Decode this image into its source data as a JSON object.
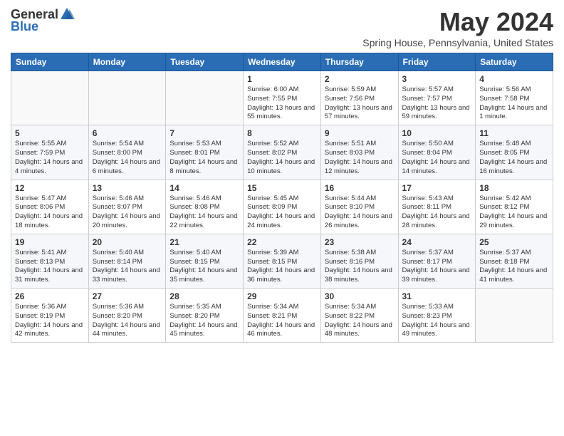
{
  "logo": {
    "general": "General",
    "blue": "Blue"
  },
  "header": {
    "month_year": "May 2024",
    "location": "Spring House, Pennsylvania, United States"
  },
  "weekdays": [
    "Sunday",
    "Monday",
    "Tuesday",
    "Wednesday",
    "Thursday",
    "Friday",
    "Saturday"
  ],
  "weeks": [
    [
      {
        "day": "",
        "sunrise": "",
        "sunset": "",
        "daylight": ""
      },
      {
        "day": "",
        "sunrise": "",
        "sunset": "",
        "daylight": ""
      },
      {
        "day": "",
        "sunrise": "",
        "sunset": "",
        "daylight": ""
      },
      {
        "day": "1",
        "sunrise": "Sunrise: 6:00 AM",
        "sunset": "Sunset: 7:55 PM",
        "daylight": "Daylight: 13 hours and 55 minutes."
      },
      {
        "day": "2",
        "sunrise": "Sunrise: 5:59 AM",
        "sunset": "Sunset: 7:56 PM",
        "daylight": "Daylight: 13 hours and 57 minutes."
      },
      {
        "day": "3",
        "sunrise": "Sunrise: 5:57 AM",
        "sunset": "Sunset: 7:57 PM",
        "daylight": "Daylight: 13 hours and 59 minutes."
      },
      {
        "day": "4",
        "sunrise": "Sunrise: 5:56 AM",
        "sunset": "Sunset: 7:58 PM",
        "daylight": "Daylight: 14 hours and 1 minute."
      }
    ],
    [
      {
        "day": "5",
        "sunrise": "Sunrise: 5:55 AM",
        "sunset": "Sunset: 7:59 PM",
        "daylight": "Daylight: 14 hours and 4 minutes."
      },
      {
        "day": "6",
        "sunrise": "Sunrise: 5:54 AM",
        "sunset": "Sunset: 8:00 PM",
        "daylight": "Daylight: 14 hours and 6 minutes."
      },
      {
        "day": "7",
        "sunrise": "Sunrise: 5:53 AM",
        "sunset": "Sunset: 8:01 PM",
        "daylight": "Daylight: 14 hours and 8 minutes."
      },
      {
        "day": "8",
        "sunrise": "Sunrise: 5:52 AM",
        "sunset": "Sunset: 8:02 PM",
        "daylight": "Daylight: 14 hours and 10 minutes."
      },
      {
        "day": "9",
        "sunrise": "Sunrise: 5:51 AM",
        "sunset": "Sunset: 8:03 PM",
        "daylight": "Daylight: 14 hours and 12 minutes."
      },
      {
        "day": "10",
        "sunrise": "Sunrise: 5:50 AM",
        "sunset": "Sunset: 8:04 PM",
        "daylight": "Daylight: 14 hours and 14 minutes."
      },
      {
        "day": "11",
        "sunrise": "Sunrise: 5:48 AM",
        "sunset": "Sunset: 8:05 PM",
        "daylight": "Daylight: 14 hours and 16 minutes."
      }
    ],
    [
      {
        "day": "12",
        "sunrise": "Sunrise: 5:47 AM",
        "sunset": "Sunset: 8:06 PM",
        "daylight": "Daylight: 14 hours and 18 minutes."
      },
      {
        "day": "13",
        "sunrise": "Sunrise: 5:46 AM",
        "sunset": "Sunset: 8:07 PM",
        "daylight": "Daylight: 14 hours and 20 minutes."
      },
      {
        "day": "14",
        "sunrise": "Sunrise: 5:46 AM",
        "sunset": "Sunset: 8:08 PM",
        "daylight": "Daylight: 14 hours and 22 minutes."
      },
      {
        "day": "15",
        "sunrise": "Sunrise: 5:45 AM",
        "sunset": "Sunset: 8:09 PM",
        "daylight": "Daylight: 14 hours and 24 minutes."
      },
      {
        "day": "16",
        "sunrise": "Sunrise: 5:44 AM",
        "sunset": "Sunset: 8:10 PM",
        "daylight": "Daylight: 14 hours and 26 minutes."
      },
      {
        "day": "17",
        "sunrise": "Sunrise: 5:43 AM",
        "sunset": "Sunset: 8:11 PM",
        "daylight": "Daylight: 14 hours and 28 minutes."
      },
      {
        "day": "18",
        "sunrise": "Sunrise: 5:42 AM",
        "sunset": "Sunset: 8:12 PM",
        "daylight": "Daylight: 14 hours and 29 minutes."
      }
    ],
    [
      {
        "day": "19",
        "sunrise": "Sunrise: 5:41 AM",
        "sunset": "Sunset: 8:13 PM",
        "daylight": "Daylight: 14 hours and 31 minutes."
      },
      {
        "day": "20",
        "sunrise": "Sunrise: 5:40 AM",
        "sunset": "Sunset: 8:14 PM",
        "daylight": "Daylight: 14 hours and 33 minutes."
      },
      {
        "day": "21",
        "sunrise": "Sunrise: 5:40 AM",
        "sunset": "Sunset: 8:15 PM",
        "daylight": "Daylight: 14 hours and 35 minutes."
      },
      {
        "day": "22",
        "sunrise": "Sunrise: 5:39 AM",
        "sunset": "Sunset: 8:15 PM",
        "daylight": "Daylight: 14 hours and 36 minutes."
      },
      {
        "day": "23",
        "sunrise": "Sunrise: 5:38 AM",
        "sunset": "Sunset: 8:16 PM",
        "daylight": "Daylight: 14 hours and 38 minutes."
      },
      {
        "day": "24",
        "sunrise": "Sunrise: 5:37 AM",
        "sunset": "Sunset: 8:17 PM",
        "daylight": "Daylight: 14 hours and 39 minutes."
      },
      {
        "day": "25",
        "sunrise": "Sunrise: 5:37 AM",
        "sunset": "Sunset: 8:18 PM",
        "daylight": "Daylight: 14 hours and 41 minutes."
      }
    ],
    [
      {
        "day": "26",
        "sunrise": "Sunrise: 5:36 AM",
        "sunset": "Sunset: 8:19 PM",
        "daylight": "Daylight: 14 hours and 42 minutes."
      },
      {
        "day": "27",
        "sunrise": "Sunrise: 5:36 AM",
        "sunset": "Sunset: 8:20 PM",
        "daylight": "Daylight: 14 hours and 44 minutes."
      },
      {
        "day": "28",
        "sunrise": "Sunrise: 5:35 AM",
        "sunset": "Sunset: 8:20 PM",
        "daylight": "Daylight: 14 hours and 45 minutes."
      },
      {
        "day": "29",
        "sunrise": "Sunrise: 5:34 AM",
        "sunset": "Sunset: 8:21 PM",
        "daylight": "Daylight: 14 hours and 46 minutes."
      },
      {
        "day": "30",
        "sunrise": "Sunrise: 5:34 AM",
        "sunset": "Sunset: 8:22 PM",
        "daylight": "Daylight: 14 hours and 48 minutes."
      },
      {
        "day": "31",
        "sunrise": "Sunrise: 5:33 AM",
        "sunset": "Sunset: 8:23 PM",
        "daylight": "Daylight: 14 hours and 49 minutes."
      },
      {
        "day": "",
        "sunrise": "",
        "sunset": "",
        "daylight": ""
      }
    ]
  ]
}
